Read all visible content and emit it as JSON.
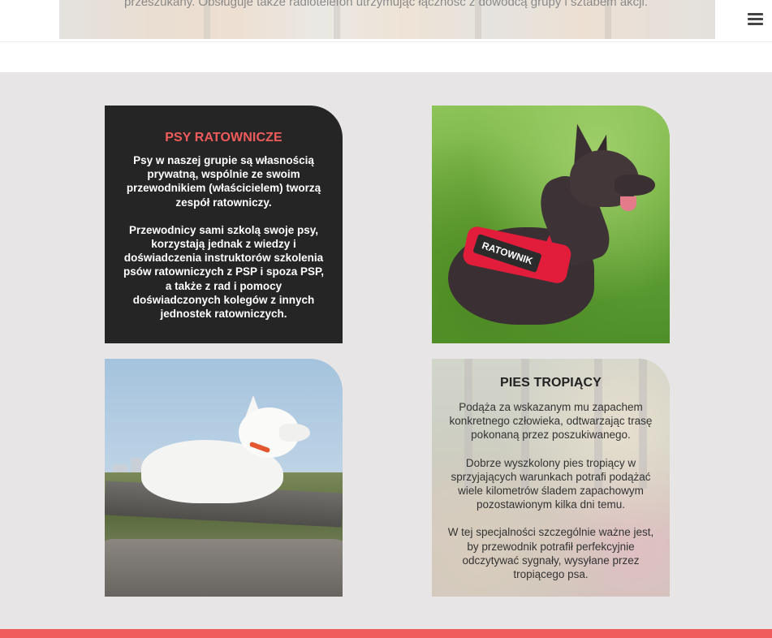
{
  "header": {
    "intro_text": "przeszukany. Obsługuje także radiotelefon utrzymując łączność z dowódcą grupy i sztabem akcji.",
    "menu_icon": "hamburger-menu-icon"
  },
  "cards": {
    "rescue_dogs": {
      "title": "PSY RATOWNICZE",
      "paragraphs": [
        "Psy w naszej grupie są własnością prywatną, wspólnie ze swoim przewodnikiem (właścicielem) tworzą zespół ratowniczy.",
        "Przewodnicy sami szkolą swoje psy, korzystają jednak z wiedzy i doświadczenia instruktorów szkolenia psów ratowniczych z PSP i spoza PSP, a także z rad i pomocy doświadczonych kolegów z innych jednostek ratowniczych."
      ]
    },
    "tracking_dog": {
      "title": "PIES TROPIĄCY",
      "paragraphs": [
        "Podąża za wskazanym mu zapachem konkretnego człowieka, odtwarzając trasę pokonaną przez poszukiwanego.",
        "Dobrze wyszkolony pies tropiący w sprzyjających warunkach potrafi podążać wiele kilometrów śladem zapachowym pozostawionym kilka dni temu.",
        "W tej specjalności szczególnie ważne jest, by przewodnik potrafił perfekcyjnie odczytywać sygnały, wysyłane przez tropiącego psa."
      ]
    }
  },
  "photos": {
    "dog_on_grass": {
      "harness_text": "RATOWNIK"
    }
  },
  "colors": {
    "accent": "#f05b5b",
    "dark_card": "#252525",
    "section_bg": "#e7e5e6"
  }
}
